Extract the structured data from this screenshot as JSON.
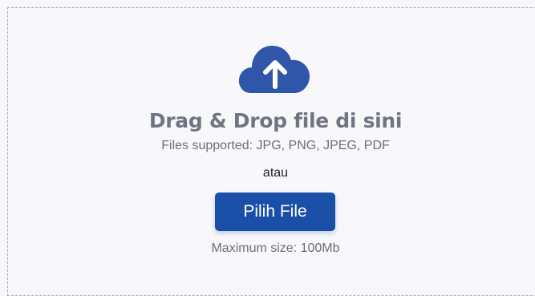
{
  "upload": {
    "icon": "cloud-upload-icon",
    "title": "Drag & Drop file di sini",
    "supported_formats": "Files supported: JPG, PNG, JPEG, PDF",
    "separator": "atau",
    "choose_button_label": "Pilih File",
    "max_size": "Maximum size: 100Mb"
  },
  "colors": {
    "accent": "#1a4fa8",
    "icon": "#2f56a8",
    "title": "#6f7582",
    "muted_text": "#6b6f77"
  }
}
